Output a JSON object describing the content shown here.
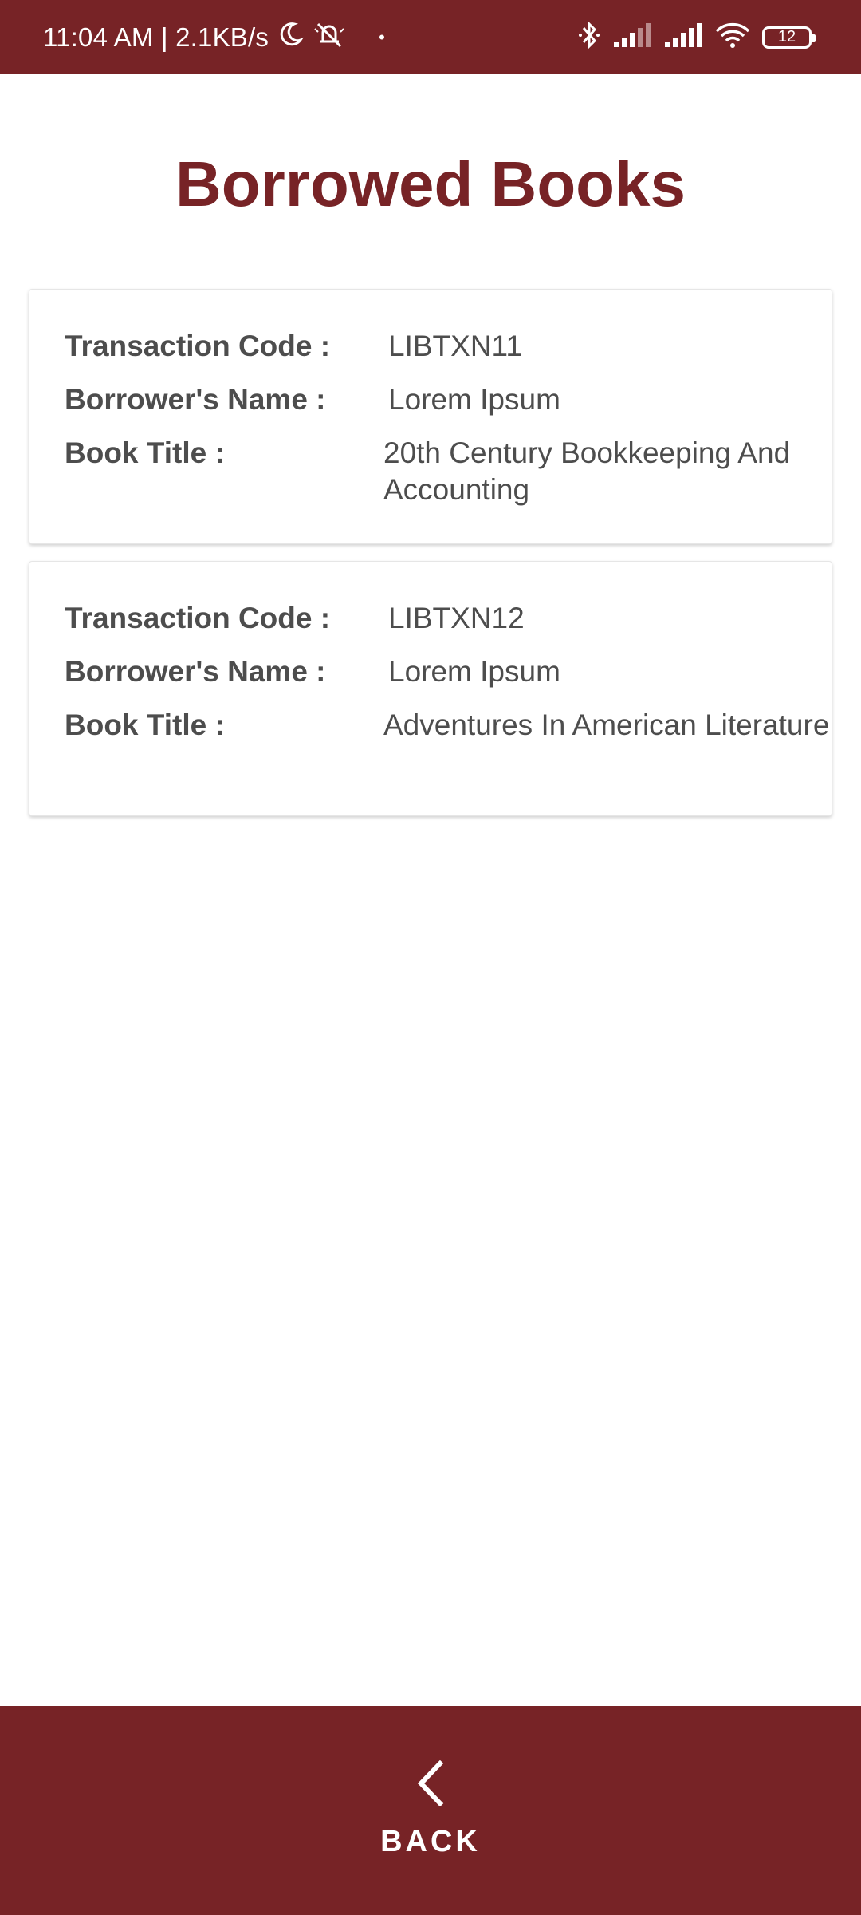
{
  "status_bar": {
    "time_speed": "11:04 AM | 2.1KB/s",
    "dot": "•",
    "battery": "12",
    "icons": [
      "moon-icon",
      "mute-icon",
      "bluetooth-icon",
      "signal-icon",
      "signal-icon",
      "wifi-icon",
      "battery-icon"
    ]
  },
  "page": {
    "title": "Borrowed Books"
  },
  "labels": {
    "transaction_code": "Transaction Code :",
    "borrower_name": "Borrower's Name :",
    "book_title": "Book Title :"
  },
  "records": [
    {
      "transaction_code": "LIBTXN11",
      "borrower_name": "Lorem Ipsum",
      "book_title": "20th Century Bookkeeping And Accounting"
    },
    {
      "transaction_code": "LIBTXN12",
      "borrower_name": "Lorem Ipsum",
      "book_title": "Adventures In American Literature"
    }
  ],
  "footer": {
    "back_label": "BACK"
  },
  "colors": {
    "brand": "#772326",
    "text": "#4d4d4d",
    "background": "#ffffff"
  }
}
